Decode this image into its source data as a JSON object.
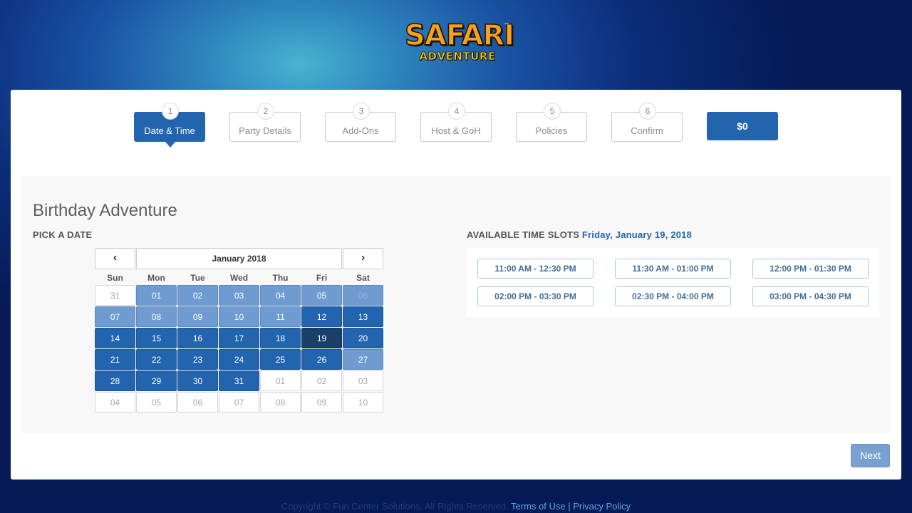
{
  "logo": {
    "top": "SAFARI",
    "bottom": "ADVENTURE",
    "tm": "™"
  },
  "steps": [
    {
      "num": "1",
      "label": "Date & Time"
    },
    {
      "num": "2",
      "label": "Party Details"
    },
    {
      "num": "3",
      "label": "Add-Ons"
    },
    {
      "num": "4",
      "label": "Host & GoH"
    },
    {
      "num": "5",
      "label": "Policies"
    },
    {
      "num": "6",
      "label": "Confirm"
    }
  ],
  "price": "$0",
  "title": "Birthday Adventure",
  "pick_date_label": "PICK A DATE",
  "calendar": {
    "prev_icon": "chevron-left-icon",
    "next_icon": "chevron-right-icon",
    "month_label": "January 2018",
    "weekdays": [
      "Sun",
      "Mon",
      "Tue",
      "Wed",
      "Thu",
      "Fri",
      "Sat"
    ],
    "days": [
      [
        "31",
        "01",
        "02",
        "03",
        "04",
        "05",
        "06"
      ],
      [
        "07",
        "08",
        "09",
        "10",
        "11",
        "12",
        "13"
      ],
      [
        "14",
        "15",
        "16",
        "17",
        "18",
        "19",
        "20"
      ],
      [
        "21",
        "22",
        "23",
        "24",
        "25",
        "26",
        "27"
      ],
      [
        "28",
        "29",
        "30",
        "31",
        "01",
        "02",
        "03"
      ],
      [
        "04",
        "05",
        "06",
        "07",
        "08",
        "09",
        "10"
      ]
    ],
    "selected": "19"
  },
  "slots": {
    "label": "AVAILABLE TIME SLOTS",
    "date": "Friday, January 19, 2018",
    "items": [
      "11:00 AM - 12:30 PM",
      "11:30 AM - 01:00 PM",
      "12:00 PM - 01:30 PM",
      "02:00 PM - 03:30 PM",
      "02:30 PM - 04:00 PM",
      "03:00 PM - 04:30 PM"
    ]
  },
  "next_label": "Next",
  "footer": {
    "copyright": "Copyright © Fun Center Solutions. All Rights Reserved.",
    "terms": "Terms of Use",
    "sep": "|",
    "privacy": "Privacy Policy"
  },
  "colors": {
    "accent": "#2364ae",
    "light_day": "#6f9bd1",
    "selected_day": "#1b3f6b"
  }
}
